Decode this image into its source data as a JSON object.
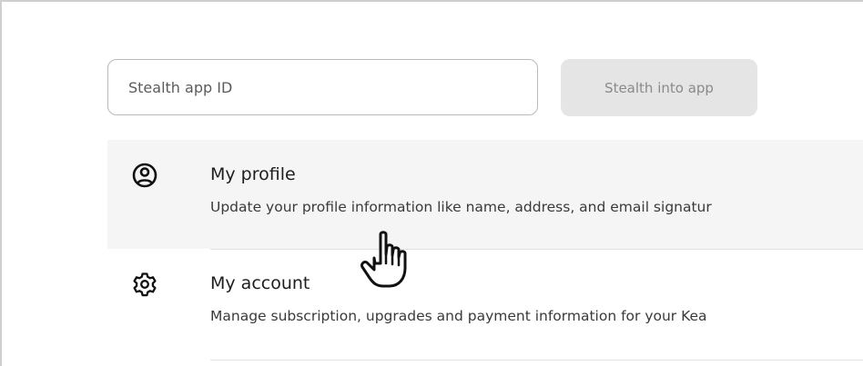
{
  "stealth": {
    "input_placeholder": "Stealth app ID",
    "input_value": "",
    "button_label": "Stealth into app"
  },
  "menu": {
    "items": [
      {
        "title": "My profile",
        "description": "Update your profile information like name, address, and email signatur",
        "icon": "user-circle-icon",
        "hovered": true
      },
      {
        "title": "My account",
        "description": "Manage subscription, upgrades and payment information for your Kea",
        "icon": "gear-icon",
        "hovered": false
      }
    ]
  },
  "cursor": {
    "icon": "hand-pointer-cursor-icon"
  }
}
